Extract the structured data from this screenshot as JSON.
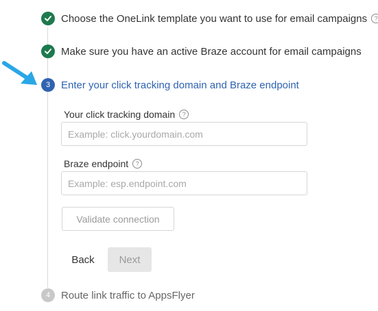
{
  "steps": [
    {
      "status": "done",
      "label": "Choose the OneLink template you want to use for email campaigns",
      "has_help": true
    },
    {
      "status": "done",
      "label": "Make sure you have an active Braze account for email campaigns",
      "has_help": false
    },
    {
      "status": "active",
      "number": "3",
      "label": "Enter your click tracking domain and Braze endpoint"
    },
    {
      "status": "pending",
      "number": "4",
      "label": "Route link traffic to AppsFlyer"
    }
  ],
  "form": {
    "tracking_domain": {
      "label": "Your click tracking domain",
      "value": "",
      "placeholder": "Example: click.yourdomain.com"
    },
    "endpoint": {
      "label": "Braze endpoint",
      "value": "",
      "placeholder": "Example: esp.endpoint.com"
    },
    "validate_label": "Validate connection",
    "back_label": "Back",
    "next_label": "Next"
  },
  "icons": {
    "done": "checkmark-icon",
    "help": "question-circle-icon",
    "pointer": "pointer-arrow-icon"
  },
  "colors": {
    "done": "#1e7a4e",
    "active": "#2f63b0",
    "pending": "#c8c8c8",
    "pointer_arrow": "#2aa7e6"
  }
}
